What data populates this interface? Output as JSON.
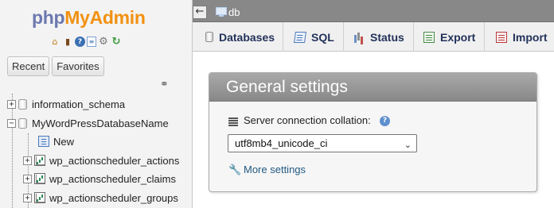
{
  "nav": {
    "logo": {
      "php": "php",
      "myadmin": "MyAdmin"
    },
    "icons": [
      "home-icon",
      "exit-icon",
      "help-icon",
      "docs-icon",
      "settings-icon",
      "reload-icon"
    ],
    "tabs": {
      "recent": "Recent",
      "favorites": "Favorites"
    },
    "tree": {
      "db1": "information_schema",
      "db2": "MyWordPressDatabaseName",
      "new": "New",
      "tables": [
        "wp_actionscheduler_actions",
        "wp_actionscheduler_claims",
        "wp_actionscheduler_groups"
      ]
    }
  },
  "topbar": {
    "breadcrumb": "db"
  },
  "tabs": [
    {
      "label": "Databases",
      "icon": "database-icon"
    },
    {
      "label": "SQL",
      "icon": "sql-icon"
    },
    {
      "label": "Status",
      "icon": "status-icon"
    },
    {
      "label": "Export",
      "icon": "export-icon"
    },
    {
      "label": "Import",
      "icon": "import-icon"
    }
  ],
  "general_settings": {
    "title": "General settings",
    "collation_label": "Server connection collation:",
    "collation_value": "utf8mb4_unicode_ci",
    "more_settings": "More settings"
  },
  "colors": {
    "logo_php": "#6c78b0",
    "logo_myadmin": "#f29111",
    "topbar": "#888888",
    "link": "#235a81"
  }
}
